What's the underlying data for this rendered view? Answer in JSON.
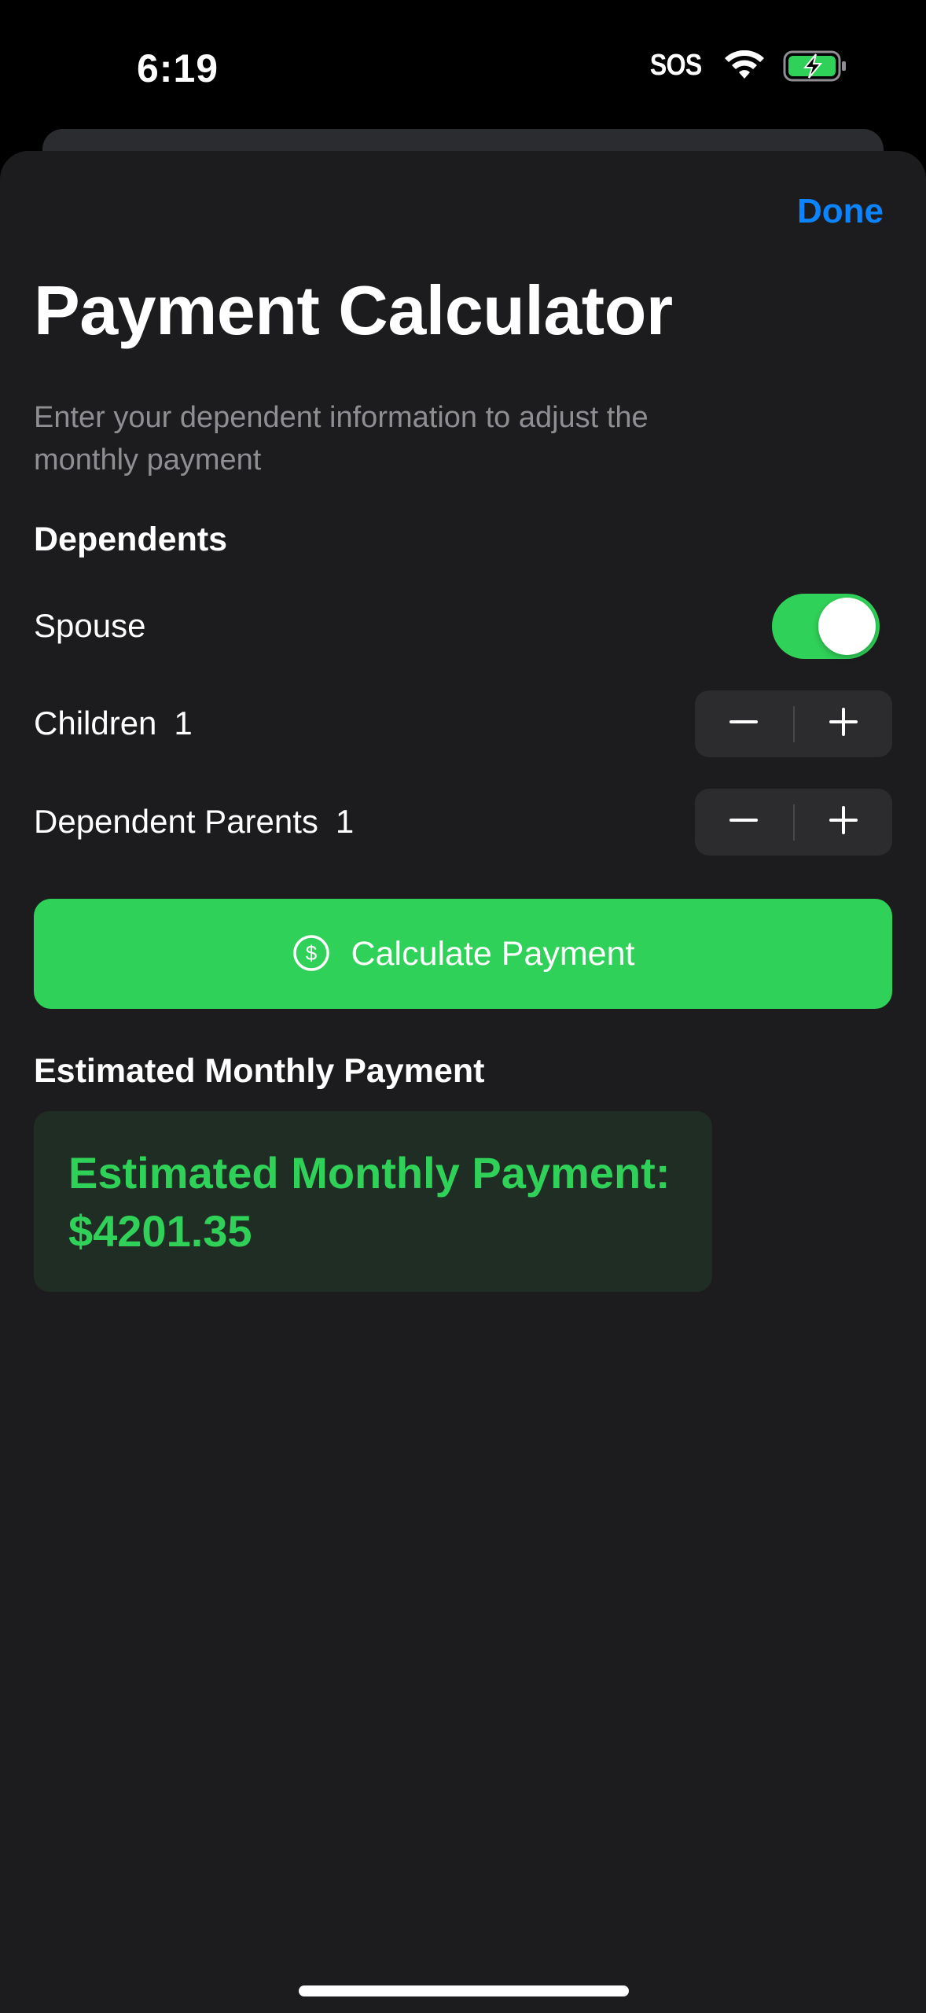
{
  "status_bar": {
    "time": "6:19",
    "sos": "SOS",
    "icons": [
      "wifi-icon",
      "battery-charging-icon"
    ]
  },
  "header": {
    "done_label": "Done",
    "title": "Payment Calculator",
    "subtitle": "Enter your dependent information to adjust the monthly payment"
  },
  "dependents": {
    "section_label": "Dependents",
    "spouse": {
      "label": "Spouse",
      "enabled": true
    },
    "children": {
      "label": "Children",
      "count": "1"
    },
    "parents": {
      "label": "Dependent Parents",
      "count": "1"
    }
  },
  "action": {
    "calculate_label": "Calculate Payment",
    "icon": "dollar-circle-icon"
  },
  "result": {
    "section_label": "Estimated Monthly Payment",
    "line1": "Estimated Monthly Payment:",
    "line2": "$4201.35"
  },
  "colors": {
    "accent_blue": "#0a84ff",
    "accent_green": "#30d158",
    "sheet_bg": "#1c1c1e",
    "secondary_text": "#8e8e93"
  }
}
